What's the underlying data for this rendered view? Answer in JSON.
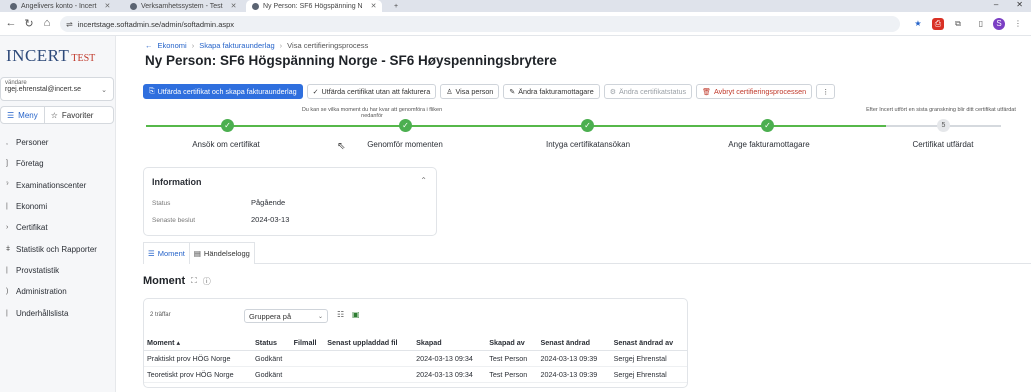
{
  "browser": {
    "tabs": [
      {
        "label": "Angelivers konto - Incert"
      },
      {
        "label": "Verksamhetssystem - Test"
      },
      {
        "label": "Ny Person: SF6 Högspänning N"
      }
    ],
    "url": "incertstage.softadmin.se/admin/softadmin.aspx"
  },
  "sidebar": {
    "logo_main": "INCERT",
    "logo_sub": "TEST",
    "user_label": "vändare",
    "user_email": "rgej.ehrenstal@incert.se",
    "menu_label": "Meny",
    "favorites_label": "Favoriter",
    "items": [
      {
        "label": "Personer"
      },
      {
        "label": "Företag"
      },
      {
        "label": "Examinationscenter"
      },
      {
        "label": "Ekonomi"
      },
      {
        "label": "Certifikat"
      },
      {
        "label": "Statistik och Rapporter"
      },
      {
        "label": "Provstatistik"
      },
      {
        "label": "Administration"
      },
      {
        "label": "Underhållslista"
      }
    ]
  },
  "breadcrumb": [
    "Ekonomi",
    "Skapa fakturaunderlag",
    "Visa certifieringsprocess"
  ],
  "page_title": "Ny Person: SF6 Högspänning Norge - SF6 Høyspenningsbrytere",
  "actions": {
    "issue_invoice": "Utfärda certifikat och skapa fakturaunderlag",
    "issue_no_invoice": "Utfärda certifikat utan att fakturera",
    "view_person": "Visa person",
    "change_recipient": "Ändra fakturamottagare",
    "change_status": "Ändra certifikatstatus",
    "cancel_process": "Avbryt certifieringsprocessen",
    "more": "⋮"
  },
  "stepper": {
    "hint_step2": "Du kan se vilka moment du har kvar att genomföra i fliken nedanför",
    "hint_step5": "Efter Incert utfört en sista granskning blir ditt certifikat utfärdat",
    "step5_number": "5",
    "steps": [
      {
        "label": "Ansök om certifikat",
        "done": true
      },
      {
        "label": "Genomför momenten",
        "done": true
      },
      {
        "label": "Intyga certifikatansökan",
        "done": true
      },
      {
        "label": "Ange fakturamottagare",
        "done": true
      },
      {
        "label": "Certifikat utfärdat",
        "done": false
      }
    ]
  },
  "information": {
    "title": "Information",
    "status_label": "Status",
    "status_value": "Pågående",
    "last_decision_label": "Senaste beslut",
    "last_decision_value": "2024-03-13"
  },
  "tabs": {
    "moment": "Moment",
    "event_log": "Händelselogg"
  },
  "section": {
    "title": "Moment"
  },
  "table": {
    "hits": "2 träffar",
    "group_by": "Gruppera på",
    "columns": [
      "Moment ▴",
      "Status",
      "Filmall",
      "Senast uppladdad fil",
      "Skapad",
      "Skapad av",
      "Senast ändrad",
      "Senast ändrad av"
    ],
    "rows": [
      [
        "Praktiskt prov HÖG Norge",
        "Godkänt",
        "",
        "",
        "2024-03-13 09:34",
        "Test Person",
        "2024-03-13 09:39",
        "Sergej Ehrenstal"
      ],
      [
        "Teoretiskt prov HÖG Norge",
        "Godkänt",
        "",
        "",
        "2024-03-13 09:34",
        "Test Person",
        "2024-03-13 09:39",
        "Sergej Ehrenstal"
      ]
    ]
  },
  "colors": {
    "primary": "#2f6fde",
    "success": "#4caf50",
    "danger": "#c0392b",
    "link": "#2563c9"
  }
}
